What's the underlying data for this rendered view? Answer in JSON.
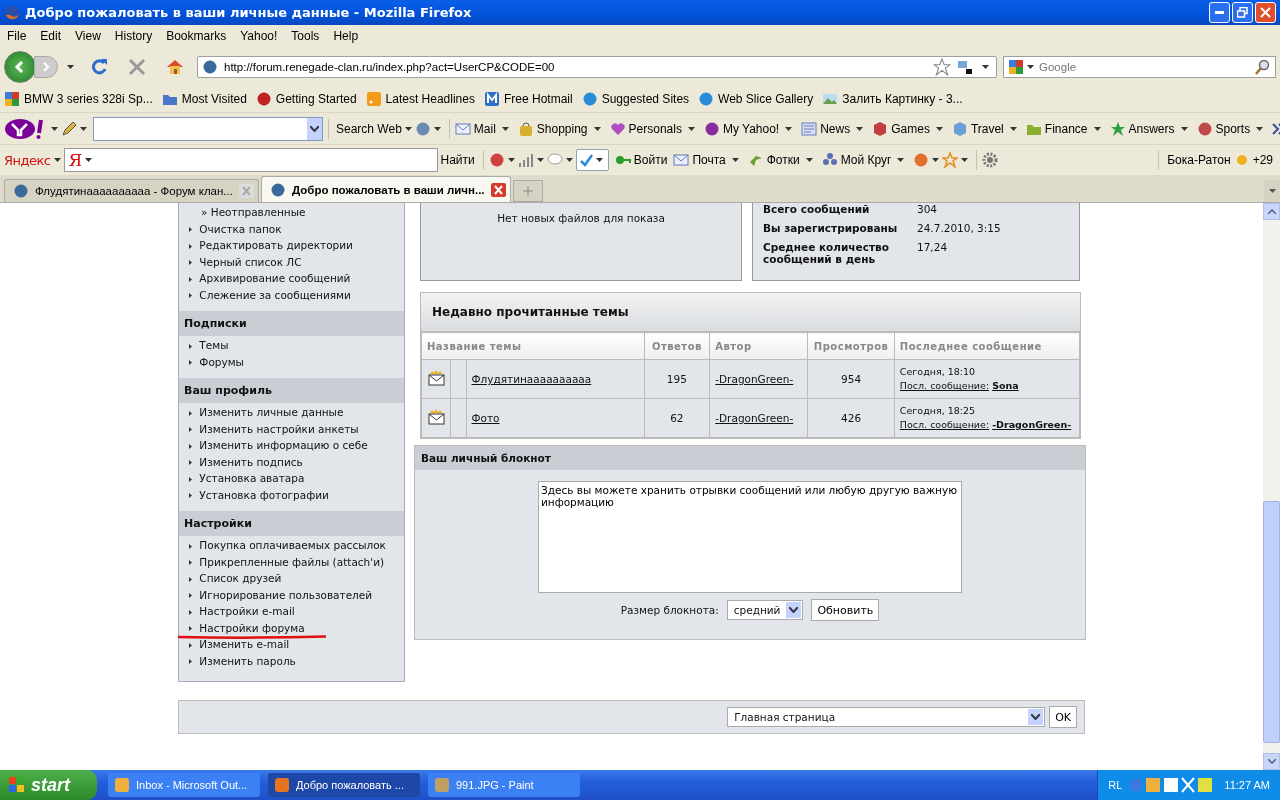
{
  "window": {
    "title": "Добро пожаловать в ваши личные данные - Mozilla Firefox"
  },
  "menu": [
    "File",
    "Edit",
    "View",
    "History",
    "Bookmarks",
    "Yahoo!",
    "Tools",
    "Help"
  ],
  "navigation": {
    "url": "http://forum.renegade-clan.ru/index.php?act=UserCP&CODE=00",
    "search_placeholder": "Google"
  },
  "bookmarks": [
    "BMW 3 series 328i Sp...",
    "Most Visited",
    "Getting Started",
    "Latest Headlines",
    "Free Hotmail",
    "Suggested Sites",
    "Web Slice Gallery",
    "Залить Картинку - 3..."
  ],
  "yahoo_toolbar": {
    "search_button": "Search Web",
    "items": [
      "Mail",
      "Shopping",
      "Personals",
      "My Yahoo!",
      "News",
      "Games",
      "Travel",
      "Finance",
      "Answers",
      "Sports"
    ]
  },
  "yandex_toolbar": {
    "logo": "Яндекс",
    "field_logo": "Я",
    "search_button": "Найти",
    "items": [
      "Войти",
      "Почта",
      "Фотки",
      "Мой Круг"
    ],
    "city": "Бока-Ратон",
    "temperature": "+29"
  },
  "tabs": [
    {
      "label": "Флудятинаааааааааа - Форум клан...",
      "selected": false
    },
    {
      "label": "Добро пожаловать в ваши личн...",
      "selected": true
    }
  ],
  "sidebar": {
    "top_items": [
      {
        "label": "» Неотправленные",
        "kind": "sub"
      },
      {
        "label": "Очистка папок",
        "kind": "link"
      },
      {
        "label": "Редактировать директории",
        "kind": "link"
      },
      {
        "label": "Черный список ЛС",
        "kind": "link"
      },
      {
        "label": "Архивирование сообщений",
        "kind": "link"
      },
      {
        "label": "Слежение за сообщениями",
        "kind": "link"
      }
    ],
    "sections": [
      {
        "title": "Подписки",
        "items": [
          {
            "label": "Темы",
            "underlined": false
          },
          {
            "label": "Форумы",
            "underlined": false
          }
        ]
      },
      {
        "title": "Ваш профиль",
        "items": [
          {
            "label": "Изменить личные данные",
            "underlined": false
          },
          {
            "label": "Изменить настройки анкеты",
            "underlined": false
          },
          {
            "label": "Изменить информацию о себе",
            "underlined": false
          },
          {
            "label": "Изменить подпись",
            "underlined": false
          },
          {
            "label": "Установка аватара",
            "underlined": false
          },
          {
            "label": "Установка фотографии",
            "underlined": false
          }
        ]
      },
      {
        "title": "Настройки",
        "items": [
          {
            "label": "Покупка оплачиваемых рассылок",
            "underlined": false
          },
          {
            "label": "Прикрепленные файлы (attach'и)",
            "underlined": false
          },
          {
            "label": "Список друзей",
            "underlined": false
          },
          {
            "label": "Игнорирование пользователей",
            "underlined": false
          },
          {
            "label": "Настройки e-mail",
            "underlined": false
          },
          {
            "label": "Настройки форума",
            "underlined": true
          },
          {
            "label": "Изменить e-mail",
            "underlined": false
          },
          {
            "label": "Изменить пароль",
            "underlined": false
          }
        ]
      }
    ]
  },
  "attachments": {
    "message": "Нет новых файлов для показа"
  },
  "stats": [
    {
      "label": "Всего сообщений",
      "value": "304"
    },
    {
      "label": "Вы зарегистрированы",
      "value": "24.7.2010, 3:15"
    },
    {
      "label": "Среднее количество сообщений в день",
      "value": "17,24"
    }
  ],
  "recent_topics": {
    "title": "Недавно прочитанные темы",
    "columns": [
      "Название темы",
      "Ответов",
      "Автор",
      "Просмотров",
      "Последнее сообщение"
    ],
    "rows": [
      {
        "title": "Флудятинаааааааааа",
        "replies": "195",
        "author": "-DragonGreen-",
        "views": "954",
        "last_date": "Сегодня, 18:10",
        "last_label": "Посл. сообщение:",
        "last_author": "Sona"
      },
      {
        "title": "Фото",
        "replies": "62",
        "author": "-DragonGreen-",
        "views": "426",
        "last_date": "Сегодня, 18:25",
        "last_label": "Посл. сообщение:",
        "last_author": "-DragonGreen-"
      }
    ]
  },
  "notepad": {
    "title": "Ваш личный блокнот",
    "text": "Здесь вы можете хранить отрывки сообщений или любую другую важную информацию",
    "size_label": "Размер блокнота:",
    "size_value": "средний",
    "update_button": "Обновить"
  },
  "jump": {
    "value": "Главная страница",
    "button": "OK"
  },
  "taskbar": {
    "start": "start",
    "tasks": [
      {
        "label": "Inbox - Microsoft Out...",
        "selected": false
      },
      {
        "label": "Добро пожаловать ...",
        "selected": true
      },
      {
        "label": "991.JPG - Paint",
        "selected": false
      }
    ],
    "language": "RL",
    "time": "11:27 AM"
  }
}
